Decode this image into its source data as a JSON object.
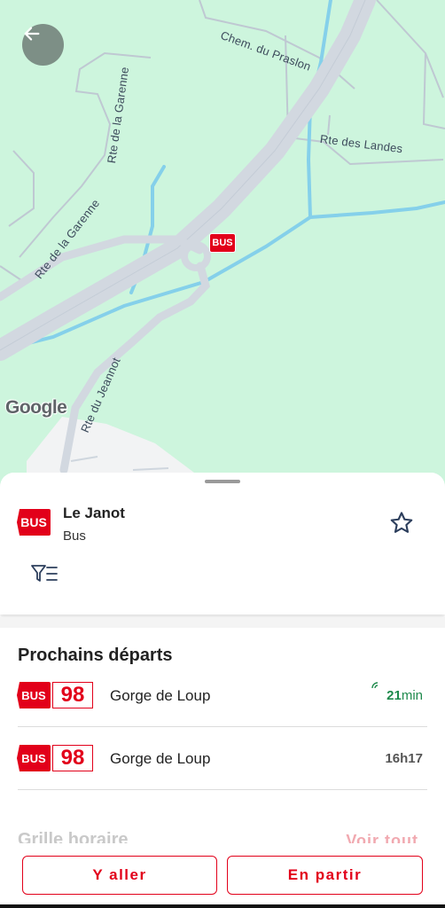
{
  "map": {
    "labels": {
      "chem_prasion": "Chem. du Praslon",
      "rte_garenne_1": "Rte de la Garenne",
      "rte_garenne_2": "Rte de la Garenne",
      "rte_landes": "Rte des Landes",
      "rte_jeannot": "Rte du Jeannot"
    },
    "google_logo": "Google",
    "marker_label": "BUS",
    "back_icon": "arrow-left-icon"
  },
  "stop": {
    "badge": "BUS",
    "name": "Le Janot",
    "type": "Bus",
    "favorite_icon": "star-outline-icon",
    "filter_icon": "filter-list-icon"
  },
  "departures": {
    "title": "Prochains départs",
    "rows": [
      {
        "badge": "BUS",
        "line": "98",
        "destination": "Gorge de Loup",
        "time_value": "21",
        "time_unit": "min",
        "realtime": true
      },
      {
        "badge": "BUS",
        "line": "98",
        "destination": "Gorge de Loup",
        "time_value": "16h17",
        "time_unit": "",
        "realtime": false
      }
    ]
  },
  "timetable": {
    "title": "Grille horaire",
    "see_all": "Voir tout"
  },
  "actions": {
    "go": "Y aller",
    "leave": "En partir"
  },
  "colors": {
    "brand_red": "#e2001a",
    "map_green": "#cdf5dd",
    "realtime_green": "#1e8a4c"
  }
}
